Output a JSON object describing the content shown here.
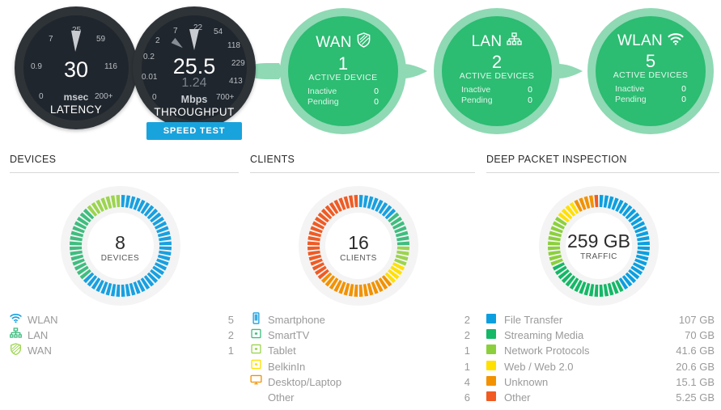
{
  "gauges": [
    {
      "id": "latency",
      "value": "30",
      "unit": "msec",
      "label": "LATENCY",
      "ticks": [
        "0",
        "0.9",
        "7",
        "25",
        "59",
        "116",
        "200+"
      ],
      "needle_deg": 2
    },
    {
      "id": "throughput",
      "value": "25.5",
      "secondary_value": "1.24",
      "unit": "Mbps",
      "label": "THROUGHPUT",
      "ticks": [
        "0",
        "0.01",
        "0.2",
        "2",
        "7",
        "22",
        "54",
        "118",
        "229",
        "413",
        "700+"
      ],
      "needle_deg": 0,
      "needle2_deg": -52
    }
  ],
  "speed_test_button": "SPEED TEST",
  "pods": [
    {
      "id": "wan",
      "title": "WAN",
      "icon": "shield-icon",
      "count": "1",
      "caption": "ACTIVE DEVICE",
      "rows": [
        {
          "label": "Inactive",
          "value": "0"
        },
        {
          "label": "Pending",
          "value": "0"
        }
      ]
    },
    {
      "id": "lan",
      "title": "LAN",
      "icon": "sitemap-icon",
      "count": "2",
      "caption": "ACTIVE DEVICES",
      "rows": [
        {
          "label": "Inactive",
          "value": "0"
        },
        {
          "label": "Pending",
          "value": "0"
        }
      ]
    },
    {
      "id": "wlan",
      "title": "WLAN",
      "icon": "wifi-icon",
      "count": "5",
      "caption": "ACTIVE DEVICES",
      "rows": [
        {
          "label": "Inactive",
          "value": "0"
        },
        {
          "label": "Pending",
          "value": "0"
        }
      ]
    }
  ],
  "panels": {
    "devices": {
      "heading": "DEVICES",
      "center_value": "8",
      "center_caption": "DEVICES",
      "legend": [
        {
          "icon": "wifi-icon",
          "name": "WLAN",
          "value": "5",
          "color": "#18a0e0"
        },
        {
          "icon": "sitemap-icon",
          "name": "LAN",
          "value": "2",
          "color": "#3fbd7f"
        },
        {
          "icon": "shield-icon",
          "name": "WAN",
          "value": "1",
          "color": "#9cd44f"
        }
      ]
    },
    "clients": {
      "heading": "CLIENTS",
      "center_value": "16",
      "center_caption": "CLIENTS",
      "legend": [
        {
          "icon": "smartphone-icon",
          "name": "Smartphone",
          "value": "2",
          "color": "#18a0e0"
        },
        {
          "icon": "smarttv-icon",
          "name": "SmartTV",
          "value": "2",
          "color": "#3fbd7f"
        },
        {
          "icon": "tablet-icon",
          "name": "Tablet",
          "value": "1",
          "color": "#9cd44f"
        },
        {
          "icon": "router-icon",
          "name": "BelkinIn",
          "value": "1",
          "color": "#ffe000"
        },
        {
          "icon": "desktop-icon",
          "name": "Desktop/Laptop",
          "value": "4",
          "color": "#f29200"
        },
        {
          "icon": "none",
          "name": "Other",
          "value": "6",
          "color": "#ef5b25"
        }
      ]
    },
    "dpi": {
      "heading": "DEEP PACKET INSPECTION",
      "center_value": "259 GB",
      "center_caption": "TRAFFIC",
      "legend": [
        {
          "icon": "swatch",
          "name": "File Transfer",
          "value": "107 GB",
          "color": "#0c9fe0"
        },
        {
          "icon": "swatch",
          "name": "Streaming Media",
          "value": "70 GB",
          "color": "#14b866"
        },
        {
          "icon": "swatch",
          "name": "Network Protocols",
          "value": "41.6 GB",
          "color": "#8bd03c"
        },
        {
          "icon": "swatch",
          "name": "Web / Web 2.0",
          "value": "20.6 GB",
          "color": "#ffe000"
        },
        {
          "icon": "swatch",
          "name": "Unknown",
          "value": "15.1 GB",
          "color": "#f29200"
        },
        {
          "icon": "swatch",
          "name": "Other",
          "value": "5.25 GB",
          "color": "#f15a22"
        }
      ]
    }
  },
  "chart_data": [
    {
      "type": "pie",
      "title": "DEVICES",
      "center_label": "8 DEVICES",
      "total": 8,
      "categories": [
        "WLAN",
        "LAN",
        "WAN"
      ],
      "values": [
        5,
        2,
        1
      ],
      "colors": [
        "#18a0e0",
        "#3fbd7f",
        "#9cd44f"
      ]
    },
    {
      "type": "pie",
      "title": "CLIENTS",
      "center_label": "16 CLIENTS",
      "total": 16,
      "categories": [
        "Smartphone",
        "SmartTV",
        "Tablet",
        "BelkinIn",
        "Desktop/Laptop",
        "Other"
      ],
      "values": [
        2,
        2,
        1,
        1,
        4,
        6
      ],
      "colors": [
        "#18a0e0",
        "#3fbd7f",
        "#9cd44f",
        "#ffe000",
        "#f29200",
        "#ef5b25"
      ]
    },
    {
      "type": "pie",
      "title": "DEEP PACKET INSPECTION",
      "center_label": "259 GB TRAFFIC",
      "total": 259.55,
      "unit": "GB",
      "categories": [
        "File Transfer",
        "Streaming Media",
        "Network Protocols",
        "Web / Web 2.0",
        "Unknown",
        "Other"
      ],
      "values": [
        107,
        70,
        41.6,
        20.6,
        15.1,
        5.25
      ],
      "colors": [
        "#0c9fe0",
        "#14b866",
        "#8bd03c",
        "#ffe000",
        "#f29200",
        "#f15a22"
      ]
    }
  ]
}
